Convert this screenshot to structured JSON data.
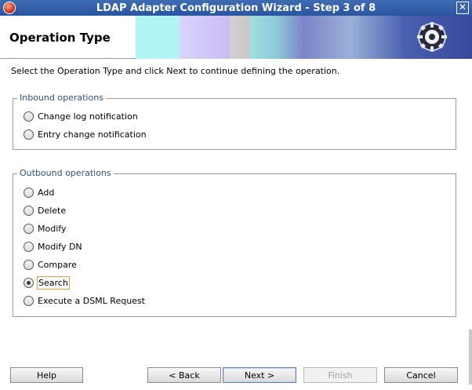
{
  "window": {
    "title": "LDAP Adapter Configuration Wizard - Step 3 of 8",
    "close_label": "✕"
  },
  "header": {
    "title": "Operation Type"
  },
  "instructions": "Select the Operation Type and click Next to continue defining the operation.",
  "inbound": {
    "title": "Inbound operations",
    "options": [
      {
        "label": "Change log notification",
        "checked": false
      },
      {
        "label": "Entry change notification",
        "checked": false
      }
    ]
  },
  "outbound": {
    "title": "Outbound operations",
    "options": [
      {
        "label": "Add",
        "checked": false
      },
      {
        "label": "Delete",
        "checked": false
      },
      {
        "label": "Modify",
        "checked": false
      },
      {
        "label": "Modify DN",
        "checked": false
      },
      {
        "label": "Compare",
        "checked": false
      },
      {
        "label": "Search",
        "checked": true
      },
      {
        "label": "Execute a DSML Request",
        "checked": false
      }
    ]
  },
  "buttons": {
    "help": "Help",
    "back": "< Back",
    "next": "Next >",
    "finish": "Finish",
    "cancel": "Cancel"
  },
  "colors": {
    "titlebar": "#2f5ca8",
    "group_title": "#2a4d8a",
    "focus_border": "#e2a23a"
  }
}
